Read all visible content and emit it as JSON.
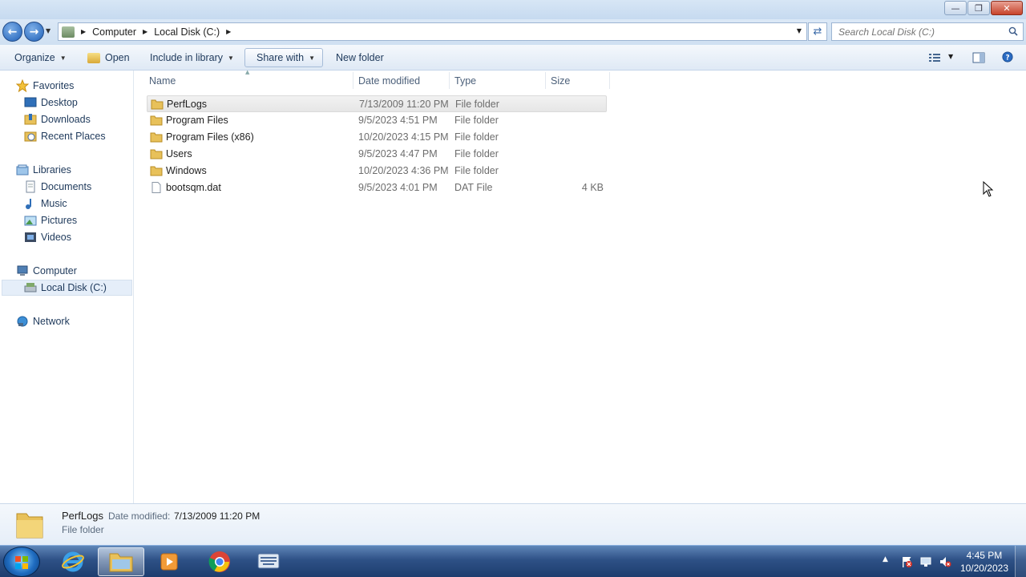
{
  "address": {
    "crumbs": [
      "Computer",
      "Local Disk (C:)"
    ],
    "search_placeholder": "Search Local Disk (C:)"
  },
  "toolbar": {
    "organize_label": "Organize",
    "open_label": "Open",
    "include_label": "Include in library",
    "share_label": "Share with",
    "new_folder_label": "New folder"
  },
  "nav": {
    "favorites": {
      "label": "Favorites",
      "items": [
        "Desktop",
        "Downloads",
        "Recent Places"
      ]
    },
    "libraries": {
      "label": "Libraries",
      "items": [
        "Documents",
        "Music",
        "Pictures",
        "Videos"
      ]
    },
    "computer": {
      "label": "Computer",
      "items": [
        "Local Disk (C:)"
      ]
    },
    "network": {
      "label": "Network"
    }
  },
  "columns": {
    "name": "Name",
    "date": "Date modified",
    "type": "Type",
    "size": "Size"
  },
  "files": [
    {
      "name": "PerfLogs",
      "date": "7/13/2009 11:20 PM",
      "type": "File folder",
      "size": "",
      "kind": "folder"
    },
    {
      "name": "Program Files",
      "date": "9/5/2023 4:51 PM",
      "type": "File folder",
      "size": "",
      "kind": "folder"
    },
    {
      "name": "Program Files (x86)",
      "date": "10/20/2023 4:15 PM",
      "type": "File folder",
      "size": "",
      "kind": "folder"
    },
    {
      "name": "Users",
      "date": "9/5/2023 4:47 PM",
      "type": "File folder",
      "size": "",
      "kind": "folder"
    },
    {
      "name": "Windows",
      "date": "10/20/2023 4:36 PM",
      "type": "File folder",
      "size": "",
      "kind": "folder"
    },
    {
      "name": "bootsqm.dat",
      "date": "9/5/2023 4:01 PM",
      "type": "DAT File",
      "size": "4 KB",
      "kind": "file"
    }
  ],
  "details": {
    "name": "PerfLogs",
    "date_label": "Date modified:",
    "date_value": "7/13/2009 11:20 PM",
    "type": "File folder"
  },
  "taskbar": {
    "time": "4:45 PM",
    "date": "10/20/2023"
  },
  "colors": {
    "accent": "#1e395b",
    "folder": "#e8c15a",
    "taskbar": "#2e5186"
  }
}
